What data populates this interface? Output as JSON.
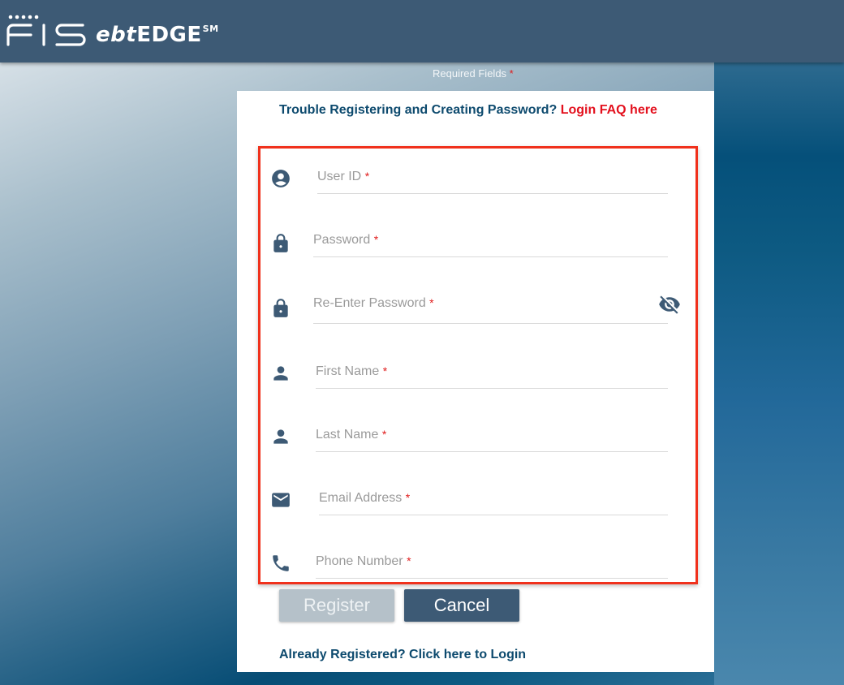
{
  "header": {
    "brand": "FIS",
    "product_prefix": "ebt",
    "product_suffix": "EDGE",
    "product_mark": "SM"
  },
  "required_note": {
    "label": "Required Fields",
    "marker": "*"
  },
  "trouble": {
    "text": "Trouble Registering and Creating Password?",
    "link": "Login FAQ here"
  },
  "fields": [
    {
      "label": "User ID",
      "required": "*",
      "icon": "account-circle-icon",
      "value": ""
    },
    {
      "label": "Password",
      "required": "*",
      "icon": "lock-icon",
      "value": ""
    },
    {
      "label": "Re-Enter Password",
      "required": "*",
      "icon": "lock-icon",
      "value": "",
      "trailing_icon": "visibility-off-icon"
    },
    {
      "label": "First Name",
      "required": "*",
      "icon": "person-icon",
      "value": ""
    },
    {
      "label": "Last Name",
      "required": "*",
      "icon": "person-icon",
      "value": ""
    },
    {
      "label": "Email Address",
      "required": "*",
      "icon": "email-icon",
      "value": ""
    },
    {
      "label": "Phone Number",
      "required": "*",
      "icon": "phone-icon",
      "value": ""
    }
  ],
  "buttons": {
    "register": "Register",
    "cancel": "Cancel"
  },
  "login_link": "Already Registered? Click here to Login",
  "colors": {
    "brand_navy": "#3d5a75",
    "link_blue": "#0d4a6e",
    "accent_red": "#e3101d",
    "highlight_border": "#f0311c"
  }
}
